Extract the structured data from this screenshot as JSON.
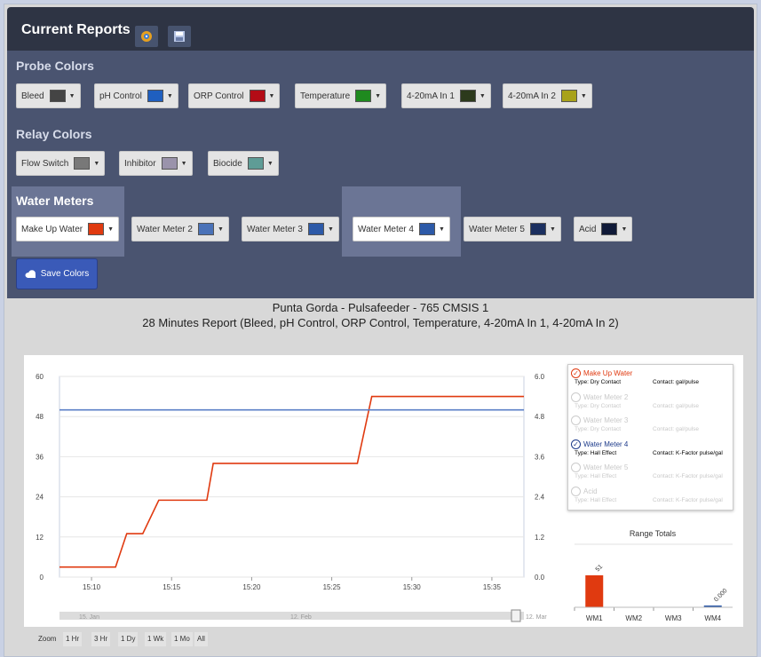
{
  "header": {
    "title": "Current Reports",
    "icons": [
      "gear-icon",
      "save-icon"
    ]
  },
  "probe": {
    "title": "Probe Colors",
    "items": [
      {
        "label": "Bleed",
        "color": "#444444"
      },
      {
        "label": "pH Control",
        "color": "#1f5fbf"
      },
      {
        "label": "ORP Control",
        "color": "#b30c16"
      },
      {
        "label": "Temperature",
        "color": "#1f8a1f"
      },
      {
        "label": "4-20mA In 1",
        "color": "#2c3a1c"
      },
      {
        "label": "4-20mA In 2",
        "color": "#a8a21a"
      }
    ]
  },
  "relay": {
    "title": "Relay Colors",
    "items": [
      {
        "label": "Flow Switch",
        "color": "#787878"
      },
      {
        "label": "Inhibitor",
        "color": "#9a93ab"
      },
      {
        "label": "Biocide",
        "color": "#5f9c96"
      }
    ]
  },
  "meters": {
    "title": "Water Meters",
    "items": [
      {
        "label": "Make Up Water",
        "color": "#e03a10"
      },
      {
        "label": "Water Meter 2",
        "color": "#4a72b8"
      },
      {
        "label": "Water Meter 3",
        "color": "#2d5aa8"
      },
      {
        "label": "Water Meter 4",
        "color": "#2d5aa8"
      },
      {
        "label": "Water Meter 5",
        "color": "#1c3060"
      },
      {
        "label": "Acid",
        "color": "#101a38"
      }
    ]
  },
  "save_label": "Save Colors",
  "report": {
    "title": "Punta Gorda - Pulsafeeder - 765 CMSIS 1",
    "subtitle": "28 Minutes Report (Bleed, pH Control, ORP Control, Temperature, 4-20mA In 1, 4-20mA In 2)"
  },
  "legend": [
    {
      "name": "Make Up Water",
      "type": "Type: Dry Contact",
      "contact": "Contact: gal/pulse",
      "checked": true
    },
    {
      "name": "Water Meter 2",
      "type": "Type: Dry Contact",
      "contact": "Contact: gal/pulse",
      "checked": false
    },
    {
      "name": "Water Meter 3",
      "type": "Type: Dry Contact",
      "contact": "Contact: gal/pulse",
      "checked": false
    },
    {
      "name": "Water Meter 4",
      "type": "Type: Hall Effect",
      "contact": "Contact: K-Factor pulse/gal",
      "checked": true
    },
    {
      "name": "Water Meter 5",
      "type": "Type: Hall Effect",
      "contact": "Contact: K-Factor pulse/gal",
      "checked": false
    },
    {
      "name": "Acid",
      "type": "Type: Hall Effect",
      "contact": "Contact: K-Factor pulse/gal",
      "checked": false
    }
  ],
  "range": {
    "title": "Range Totals",
    "categories": [
      "WM1",
      "WM2",
      "WM3",
      "WM4"
    ],
    "values": [
      51,
      0,
      0,
      0
    ],
    "labels": [
      "51",
      "",
      "",
      "0.000"
    ]
  },
  "navigator": {
    "labels": [
      "15. Jan",
      "12. Feb",
      "12. Mar"
    ]
  },
  "zoom": {
    "label": "Zoom",
    "buttons": [
      "1 Hr",
      "3 Hr",
      "1 Dy",
      "1 Wk",
      "1 Mo",
      "All"
    ]
  },
  "chart_data": {
    "type": "line",
    "xlabels": [
      "15:10",
      "15:15",
      "15:20",
      "15:25",
      "15:30",
      "15:35"
    ],
    "yleft": {
      "ticks": [
        "0",
        "12",
        "24",
        "36",
        "48",
        "60"
      ],
      "range": [
        0,
        60
      ]
    },
    "yright": {
      "ticks": [
        "0.0",
        "1.2",
        "2.4",
        "3.6",
        "4.8",
        "6.0"
      ],
      "range": [
        0,
        6
      ]
    },
    "xrange_min": [
      8,
      37
    ],
    "series": [
      {
        "name": "Make Up Water",
        "color": "#e03a10",
        "axis": "left",
        "step": true,
        "x": [
          8,
          11.5,
          12.2,
          13.2,
          14.2,
          15.1,
          16.2,
          17.2,
          17.6,
          18.9,
          21.5,
          22.6,
          26.6,
          27.5,
          33.8,
          37
        ],
        "y": [
          3,
          3,
          13,
          13,
          23,
          23,
          23,
          23,
          34,
          34,
          34,
          34,
          34,
          54,
          54,
          54
        ]
      },
      {
        "name": "Water Meter 4",
        "color": "#5b7fc7",
        "axis": "right",
        "step": false,
        "x": [
          8,
          37
        ],
        "y": [
          5,
          5
        ]
      }
    ]
  }
}
